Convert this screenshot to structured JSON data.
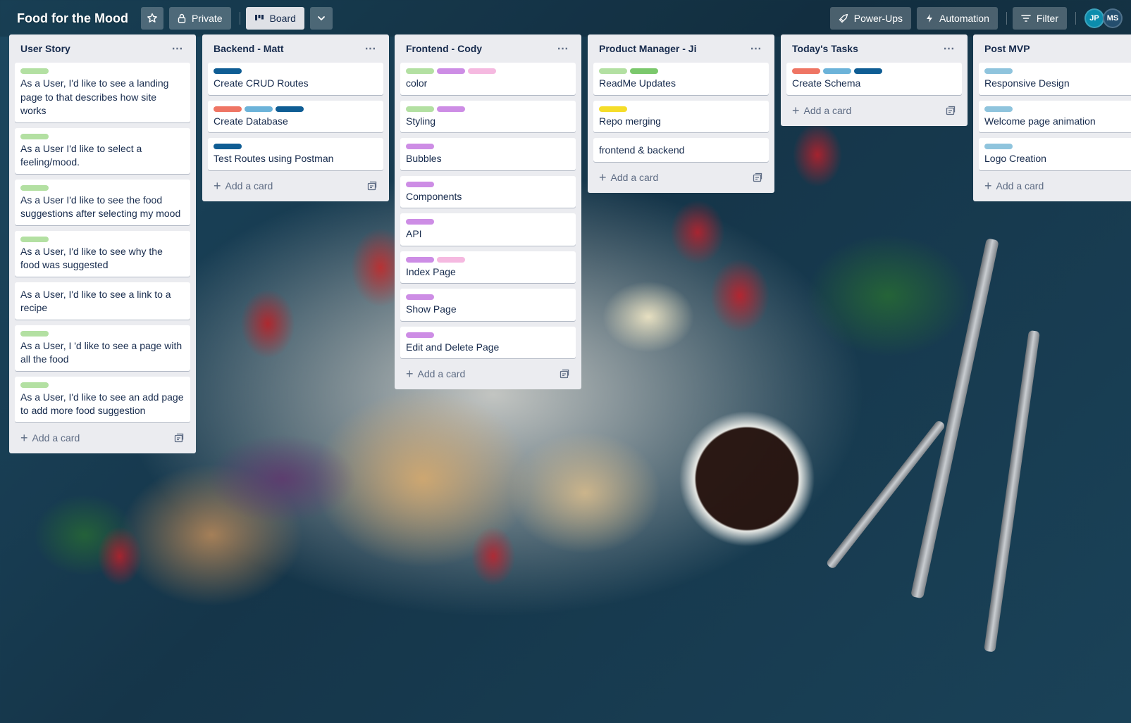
{
  "header": {
    "title": "Food for the Mood",
    "visibility_label": "Private",
    "view_label": "Board",
    "powerups_label": "Power-Ups",
    "automation_label": "Automation",
    "filter_label": "Filter",
    "avatars": [
      "JP",
      "MS"
    ]
  },
  "label_colors": {
    "green": "#b3e0a2",
    "green_dark": "#7bc86c",
    "purple": "#cd8de5",
    "pink": "#f5b9e0",
    "blue_dark": "#0f5d94",
    "blue_light": "#6cb3d9",
    "red": "#ef7564",
    "yellow": "#f5dd29",
    "sky": "#8fc4dd"
  },
  "add_card_label": "Add a card",
  "lists": [
    {
      "title": "User Story",
      "cards": [
        {
          "labels": [
            "green"
          ],
          "text": "As a User, I'd like to see a landing page to that describes how site works"
        },
        {
          "labels": [
            "green"
          ],
          "text": "As a User I'd like to select a feeling/mood."
        },
        {
          "labels": [
            "green"
          ],
          "text": "As a User I'd like to see the food suggestions after selecting my mood"
        },
        {
          "labels": [
            "green"
          ],
          "text": "As a User, I'd like to see why the food was suggested"
        },
        {
          "labels": [],
          "text": "As a User, I'd like to see a link to a recipe"
        },
        {
          "labels": [
            "green"
          ],
          "text": "As a User, I 'd like to see a page with all the food"
        },
        {
          "labels": [
            "green"
          ],
          "text": "As a User, I'd like to see an add page to add more food suggestion"
        }
      ]
    },
    {
      "title": "Backend - Matt",
      "cards": [
        {
          "labels": [
            "blue_dark"
          ],
          "text": "Create CRUD Routes"
        },
        {
          "labels": [
            "red",
            "blue_light",
            "blue_dark"
          ],
          "text": "Create Database"
        },
        {
          "labels": [
            "blue_dark"
          ],
          "text": "Test Routes using Postman"
        }
      ]
    },
    {
      "title": "Frontend - Cody",
      "cards": [
        {
          "labels": [
            "green",
            "purple",
            "pink"
          ],
          "text": "color"
        },
        {
          "labels": [
            "green",
            "purple"
          ],
          "text": "Styling"
        },
        {
          "labels": [
            "purple"
          ],
          "text": "Bubbles"
        },
        {
          "labels": [
            "purple"
          ],
          "text": "Components"
        },
        {
          "labels": [
            "purple"
          ],
          "text": "API"
        },
        {
          "labels": [
            "purple",
            "pink"
          ],
          "text": "Index Page"
        },
        {
          "labels": [
            "purple"
          ],
          "text": "Show Page"
        },
        {
          "labels": [
            "purple"
          ],
          "text": "Edit and Delete Page"
        }
      ]
    },
    {
      "title": "Product Manager - Ji",
      "cards": [
        {
          "labels": [
            "green",
            "green_dark"
          ],
          "text": "ReadMe Updates"
        },
        {
          "labels": [
            "yellow"
          ],
          "text": "Repo merging"
        },
        {
          "labels": [],
          "text": "frontend & backend"
        }
      ]
    },
    {
      "title": "Today's Tasks",
      "cards": [
        {
          "labels": [
            "red",
            "blue_light",
            "blue_dark"
          ],
          "text": "Create Schema"
        }
      ]
    },
    {
      "title": "Post MVP",
      "cards": [
        {
          "labels": [
            "sky"
          ],
          "text": "Responsive Design"
        },
        {
          "labels": [
            "sky"
          ],
          "text": "Welcome page animation"
        },
        {
          "labels": [
            "sky"
          ],
          "text": "Logo Creation"
        }
      ]
    }
  ]
}
